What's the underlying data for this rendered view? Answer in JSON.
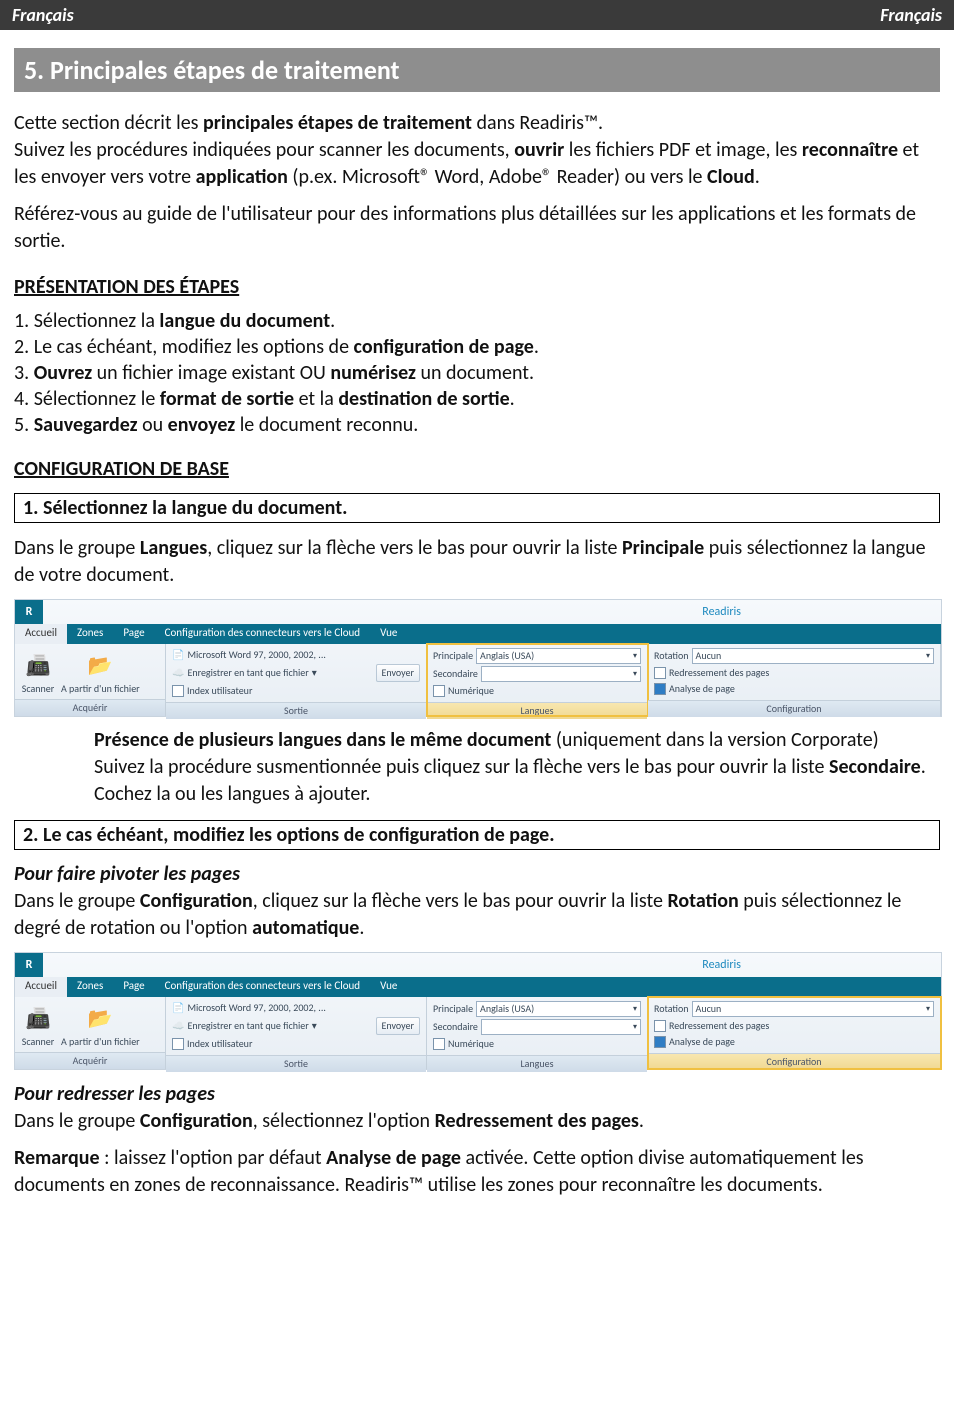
{
  "header": {
    "left": "Français",
    "right": "Français"
  },
  "title": "5. Principales étapes de traitement",
  "intro1_a": "Cette section décrit les ",
  "intro1_b": "principales étapes de traitement",
  "intro1_c": " dans Readiris™.",
  "intro2_a": "Suivez les procédures indiquées pour scanner les documents, ",
  "intro2_b": "ouvrir",
  "intro2_c": " les fichiers PDF et image, les ",
  "intro2_d": "reconnaître",
  "intro2_e": " et les envoyer vers votre ",
  "intro2_f": "application",
  "intro2_g": " (p.ex. Microsoft® Word, Adobe® Reader) ou vers le ",
  "intro2_h": "Cloud",
  "intro2_i": ".",
  "intro3": "Référez-vous au guide de l'utilisateur pour des informations plus détaillées sur les applications et les formats de sortie.",
  "heading_presentation": "PRÉSENTATION DES ÉTAPES",
  "steps": {
    "s1_a": "1. Sélectionnez la ",
    "s1_b": "langue du document",
    "s1_c": ".",
    "s2_a": "2. Le cas échéant, modifiez les options de ",
    "s2_b": "configuration de page",
    "s2_c": ".",
    "s3_a": "3. ",
    "s3_b": "Ouvrez",
    "s3_c": " un fichier image existant OU ",
    "s3_d": "numérisez",
    "s3_e": " un document.",
    "s4_a": "4. Sélectionnez le ",
    "s4_b": "format de sortie",
    "s4_c": " et la ",
    "s4_d": "destination de sortie",
    "s4_e": ".",
    "s5_a": "5. ",
    "s5_b": "Sauvegardez",
    "s5_c": " ou ",
    "s5_d": "envoyez",
    "s5_e": " le document reconnu."
  },
  "heading_config": "CONFIGURATION DE BASE",
  "box1": "1. Sélectionnez la langue du document.",
  "langues1_a": "Dans le groupe ",
  "langues1_b": "Langues",
  "langues1_c": ", cliquez sur la flèche vers le bas pour ouvrir la liste ",
  "langues1_d": "Principale",
  "langues1_e": " puis sélectionnez la langue de votre document.",
  "ribbon": {
    "app_title": "Readiris",
    "tabs": {
      "accueil": "Accueil",
      "zones": "Zones",
      "page": "Page",
      "config": "Configuration des connecteurs vers le Cloud",
      "vue": "Vue"
    },
    "acq": {
      "scanner": "Scanner",
      "apartir": "A partir d'un fichier",
      "group": "Acquérir"
    },
    "sortie": {
      "word": "Microsoft Word 97, 2000, 2002, ...",
      "enreg": "Enregistrer en tant que fichier",
      "index": "Index utilisateur",
      "envoyer": "Envoyer",
      "group": "Sortie"
    },
    "langues": {
      "principale": "Principale",
      "principale_val": "Anglais (USA)",
      "secondaire": "Secondaire",
      "numerique": "Numérique",
      "group": "Langues"
    },
    "config_grp": {
      "rotation": "Rotation",
      "rotation_val": "Aucun",
      "redress": "Redressement des pages",
      "analyse": "Analyse de page",
      "group": "Configuration"
    }
  },
  "multi_a": "Présence de plusieurs langues dans le même document",
  "multi_b": " (uniquement dans la version Corporate)",
  "multi2_a": "Suivez la procédure susmentionnée puis cliquez sur la flèche vers le bas pour ouvrir la liste ",
  "multi2_b": "Secondaire",
  "multi2_c": ". Cochez la ou les langues à ajouter.",
  "box2": "2. Le cas échéant, modifiez les options de configuration de page.",
  "pivot_heading": "Pour faire pivoter les pages",
  "pivot_a": "Dans le groupe ",
  "pivot_b": "Configuration",
  "pivot_c": ", cliquez sur la flèche vers le bas pour ouvrir la liste ",
  "pivot_d": "Rotation",
  "pivot_e": " puis sélectionnez le degré de rotation ou l'option ",
  "pivot_f": "automatique",
  "pivot_g": ".",
  "redress_heading": "Pour redresser les pages",
  "redress_a": "Dans le groupe ",
  "redress_b": "Configuration",
  "redress_c": ", sélectionnez l'option ",
  "redress_d": "Redressement des pages",
  "redress_e": ".",
  "remarque_a": "Remarque",
  "remarque_b": " : laissez l'option par défaut ",
  "remarque_c": "Analyse de page",
  "remarque_d": " activée. Cette option divise automatiquement les documents en zones de reconnaissance. Readiris™ utilise les zones pour reconnaître les documents."
}
